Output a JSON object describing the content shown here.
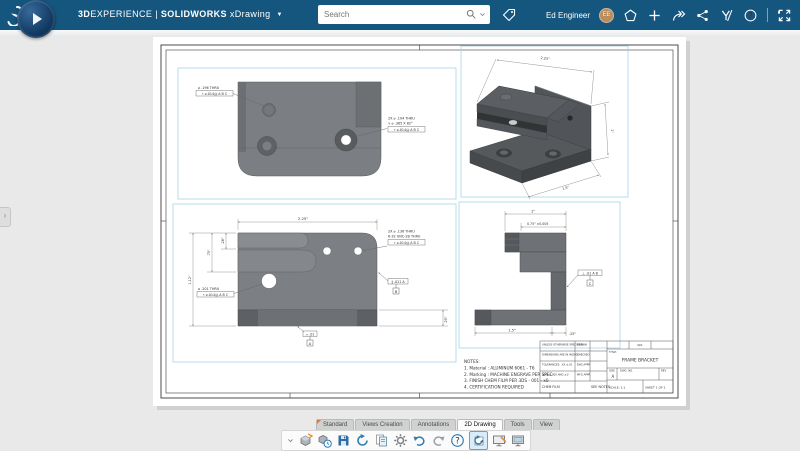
{
  "topbar": {
    "brand_3d": "3D",
    "brand_experience": "EXPERIENCE",
    "brand_sep": "|",
    "brand_product": "SOLIDWORKS",
    "brand_app": "xDrawing",
    "search_placeholder": "Search",
    "user_name": "Ed Engineer",
    "avatar_initials": "EE",
    "help_glyph": "?",
    "bar_color": "#15567F"
  },
  "side_panel": {
    "expand_glyph": "›"
  },
  "sheet": {
    "top_view": {
      "callout_hole": "⌀ .196 THRU",
      "fcf_hole": "⌖ ⌀.014Ⓜ A B C",
      "callout_csk_1": "2X ⌀ .194 THRU",
      "callout_csk_2": "∨ ⌀ .385 X 82°",
      "fcf_csk": "⌖ ⌀.014Ⓜ A B C"
    },
    "iso_view": {
      "dim_width": "2.25\"",
      "dim_height": "1\"",
      "dim_depth": "1.5\""
    },
    "front_view": {
      "dim_width": "2.25\"",
      "dim_step": ".28\"",
      "dim_slot": ".75\"",
      "dim_height": "1.12\"",
      "dim_base": ".25\"",
      "callout_tap_1": "2X ⌀ .136 THRU",
      "callout_tap_2": "6-32 UNC-2B THRU",
      "fcf_tap": "⌖ ⌀.014Ⓜ A B C",
      "callout_bore": "⌀ .201 THRU",
      "fcf_bore": "⌖ ⌀.014Ⓜ A B C",
      "fcf_parallel": "∥ .011 A",
      "datum_right": "B",
      "fcf_flat": "▱ .01",
      "datum_bottom": "A"
    },
    "side_view": {
      "dim_width": "1\"",
      "dim_slot": "0.75\" ±0.005",
      "dim_base": "1.5\"",
      "dim_thick": ".25\"",
      "fcf_perp": "⊥ .01 A B",
      "datum": "C"
    },
    "notes": [
      "NOTES:",
      "1. Material : ALUMINUM 6061 - T6",
      "2. Marking : MACHINE ENGRAVE PER SPEC",
      "3. FINISH CHEM FILM PER 3DS - 001 - x0",
      "4. CERTIFICATION REQUIRED"
    ],
    "title_block": {
      "tol_1": "UNLESS OTHERWISE SPECIFIED:",
      "tol_2": "DIMENSIONS ARE IN INCHES",
      "tol_3": "TOLERANCES: .XX ±.01",
      "tol_4": ".XXX ±.005   ANG ±1°",
      "finish": "CHEM FILM",
      "row_1": "DRAWN",
      "row_2": "CHECKED",
      "row_3": "ENG APPR",
      "row_4": "MFG APPR",
      "material": "SEE NOTES",
      "na": "N/A",
      "title_label": "TITLE:",
      "title": "FRAME BRACKET",
      "size_label": "SIZE",
      "size": "A",
      "dwg_label": "DWG. NO.",
      "rev_label": "REV",
      "scale": "SCALE: 1:1",
      "sheet_num": "SHEET 1 OF 1"
    }
  },
  "toolbar": {
    "tabs": [
      "Standard",
      "Views Creation",
      "Annotations",
      "2D Drawing",
      "Tools",
      "View"
    ],
    "active_tab": "2D Drawing",
    "icons": [
      "import-part",
      "insert-model",
      "save",
      "update",
      "print-sheet",
      "settings-gear",
      "undo",
      "redo",
      "help",
      "update-views",
      "edit-sheet",
      "sheet-format"
    ]
  }
}
